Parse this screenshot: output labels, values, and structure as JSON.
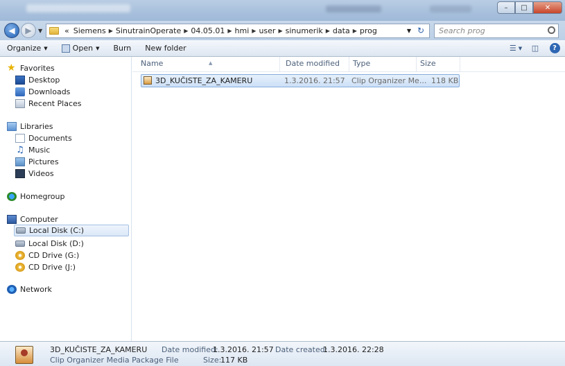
{
  "address": {
    "crumbs": [
      "«",
      "Siemens",
      "SinutrainOperate",
      "04.05.01",
      "hmi",
      "user",
      "sinumerik",
      "data",
      "prog"
    ]
  },
  "search": {
    "placeholder": "Search prog"
  },
  "toolbar": {
    "organize": "Organize",
    "open": "Open",
    "burn": "Burn",
    "new_folder": "New folder"
  },
  "nav": {
    "favorites": "Favorites",
    "desktop": "Desktop",
    "downloads": "Downloads",
    "recent": "Recent Places",
    "libraries": "Libraries",
    "documents": "Documents",
    "music": "Music",
    "pictures": "Pictures",
    "videos": "Videos",
    "homegroup": "Homegroup",
    "computer": "Computer",
    "disk_c": "Local Disk (C:)",
    "disk_d": "Local Disk (D:)",
    "cd_g": "CD Drive (G:)",
    "cd_j": "CD Drive (J:)",
    "network": "Network"
  },
  "columns": {
    "name": "Name",
    "date": "Date modified",
    "type": "Type",
    "size": "Size"
  },
  "files": [
    {
      "name": "3D_KUČISTE_ZA_KAMERU",
      "date": "1.3.2016. 21:57",
      "type": "Clip Organizer Me...",
      "size": "118 KB"
    }
  ],
  "details": {
    "name": "3D_KUČISTE_ZA_KAMERU",
    "type": "Clip Organizer Media Package File",
    "modified_label": "Date modified:",
    "modified": "1.3.2016. 21:57",
    "size_label": "Size:",
    "size": "117 KB",
    "created_label": "Date created:",
    "created": "1.3.2016. 22:28"
  }
}
